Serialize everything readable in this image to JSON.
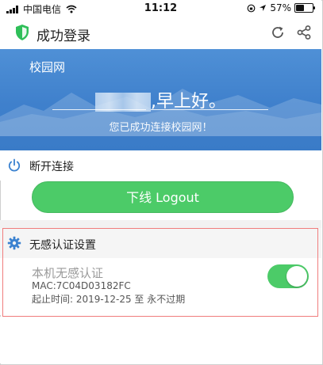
{
  "status_bar": {
    "carrier": "中国电信",
    "time": "11:12",
    "battery": "57%",
    "battery_level": 0.57
  },
  "app_bar": {
    "title": "成功登录",
    "icons": [
      "shield-check-icon",
      "refresh-icon",
      "share-icon"
    ],
    "accent_color": "#2fbf59"
  },
  "banner": {
    "campus_label": "校园网",
    "greeting": ",早上好。",
    "subtitle": "您已成功连接校园网！",
    "background_color": "#4a8ad2"
  },
  "disconnect": {
    "section_title": "断开连接",
    "logout_label": "下线 Logout",
    "button_color": "#4ccb68"
  },
  "seamless_auth": {
    "section_title": "无感认证设置",
    "item_name": "本机无感认证",
    "mac": "MAC:7C04D03182FC",
    "period": "起止时间: 2019-12-25 至 永不过期",
    "enabled": true,
    "highlight_color": "#f07d7d"
  }
}
